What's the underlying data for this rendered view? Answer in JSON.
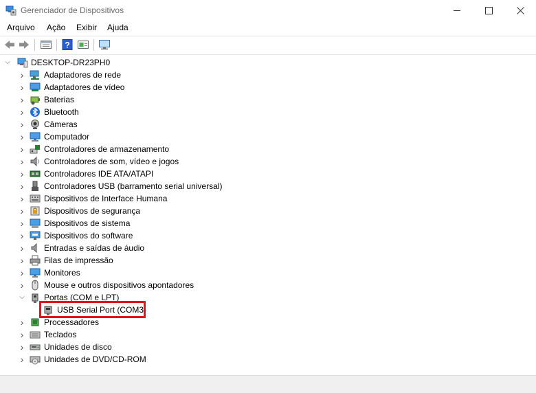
{
  "window": {
    "title": "Gerenciador de Dispositivos",
    "controls": {
      "minimize": "—",
      "maximize": "☐",
      "close": "✕"
    }
  },
  "menu": {
    "items": [
      "Arquivo",
      "Ação",
      "Exibir",
      "Ajuda"
    ]
  },
  "toolbar": {
    "buttons": [
      "back-icon",
      "forward-icon",
      "properties-icon",
      "help-icon",
      "update-driver-icon",
      "monitor-icon"
    ]
  },
  "tree": {
    "root": "DESKTOP-DR23PH0",
    "categories": [
      {
        "label": "Adaptadores de rede",
        "icon": "network-adapter-icon",
        "expanded": false
      },
      {
        "label": "Adaptadores de vídeo",
        "icon": "display-adapter-icon",
        "expanded": false
      },
      {
        "label": "Baterias",
        "icon": "battery-icon",
        "expanded": false
      },
      {
        "label": "Bluetooth",
        "icon": "bluetooth-icon",
        "expanded": false
      },
      {
        "label": "Câmeras",
        "icon": "camera-icon",
        "expanded": false
      },
      {
        "label": "Computador",
        "icon": "computer-icon",
        "expanded": false
      },
      {
        "label": "Controladores de armazenamento",
        "icon": "storage-controller-icon",
        "expanded": false
      },
      {
        "label": "Controladores de som, vídeo e jogos",
        "icon": "speaker-icon",
        "expanded": false
      },
      {
        "label": "Controladores IDE ATA/ATAPI",
        "icon": "ide-controller-icon",
        "expanded": false
      },
      {
        "label": "Controladores USB (barramento serial universal)",
        "icon": "usb-icon",
        "expanded": false
      },
      {
        "label": "Dispositivos de Interface Humana",
        "icon": "hid-icon",
        "expanded": false
      },
      {
        "label": "Dispositivos de segurança",
        "icon": "security-device-icon",
        "expanded": false
      },
      {
        "label": "Dispositivos de sistema",
        "icon": "system-device-icon",
        "expanded": false
      },
      {
        "label": "Dispositivos do software",
        "icon": "software-device-icon",
        "expanded": false
      },
      {
        "label": "Entradas e saídas de áudio",
        "icon": "audio-io-icon",
        "expanded": false
      },
      {
        "label": "Filas de impressão",
        "icon": "printer-icon",
        "expanded": false
      },
      {
        "label": "Monitores",
        "icon": "monitor-icon",
        "expanded": false
      },
      {
        "label": "Mouse e outros dispositivos apontadores",
        "icon": "mouse-icon",
        "expanded": false
      },
      {
        "label": "Portas (COM e LPT)",
        "icon": "port-icon",
        "expanded": true,
        "children": [
          {
            "label": "USB Serial Port (COM3)",
            "icon": "serial-port-icon",
            "highlighted": true
          }
        ]
      },
      {
        "label": "Processadores",
        "icon": "processor-icon",
        "expanded": false
      },
      {
        "label": "Teclados",
        "icon": "keyboard-icon",
        "expanded": false
      },
      {
        "label": "Unidades de disco",
        "icon": "disk-drive-icon",
        "expanded": false
      },
      {
        "label": "Unidades de DVD/CD-ROM",
        "icon": "dvd-drive-icon",
        "expanded": false
      }
    ]
  },
  "colors": {
    "highlight_border": "#e0141a",
    "title_text": "#6b6b6b",
    "accent": "#1f6fd6"
  }
}
